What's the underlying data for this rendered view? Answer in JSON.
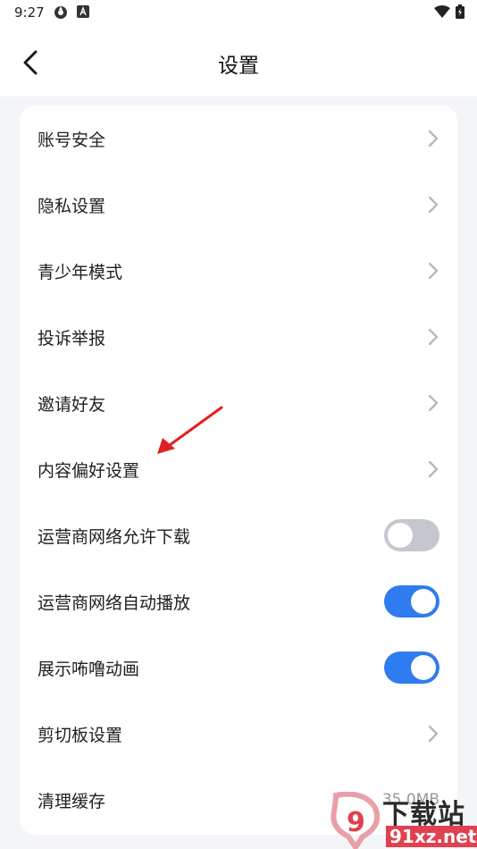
{
  "status_bar": {
    "time": "9:27"
  },
  "header": {
    "title": "设置"
  },
  "settings": {
    "items": [
      {
        "label": "账号安全"
      },
      {
        "label": "隐私设置"
      },
      {
        "label": "青少年模式"
      },
      {
        "label": "投诉举报"
      },
      {
        "label": "邀请好友"
      },
      {
        "label": "内容偏好设置"
      },
      {
        "label": "运营商网络允许下载",
        "toggle": "off"
      },
      {
        "label": "运营商网络自动播放",
        "toggle": "on"
      },
      {
        "label": "展示咘噜动画",
        "toggle": "on"
      },
      {
        "label": "剪切板设置"
      },
      {
        "label": "清理缓存",
        "value": "35.0MB"
      }
    ]
  },
  "colors": {
    "accent": "#2f7bf0",
    "toggle_off": "#c4c7ce",
    "annotation": "#e02020"
  },
  "watermark": {
    "text": "下载站",
    "url_text": "91xz.net"
  }
}
